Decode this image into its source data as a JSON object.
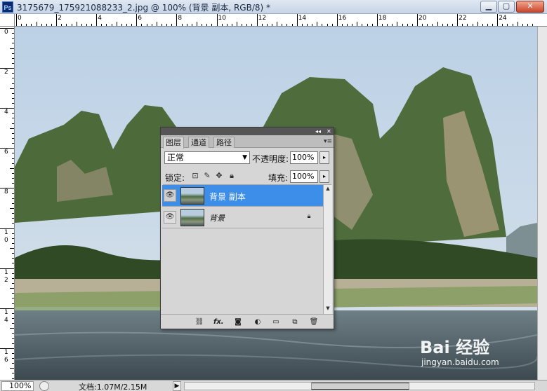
{
  "window": {
    "app_icon": "Ps",
    "title": "3175679_175921088233_2.jpg @ 100% (背景 副本, RGB/8) *",
    "buttons": {
      "minimize": "▁",
      "restore": "▢",
      "close": "✕"
    }
  },
  "ruler": {
    "top_labels": [
      "0",
      "2",
      "4",
      "6",
      "8",
      "10",
      "12",
      "14",
      "16",
      "18",
      "20",
      "22",
      "24"
    ],
    "left_labels": [
      "0",
      "2",
      "4",
      "6",
      "8",
      "1\n0",
      "1\n2",
      "1\n4",
      "1\n6"
    ]
  },
  "layers_panel": {
    "tabs": [
      {
        "label": "图层",
        "active": true
      },
      {
        "label": "通道",
        "active": false
      },
      {
        "label": "路径",
        "active": false
      }
    ],
    "collapse_icon": "◂◂",
    "close_icon": "✕",
    "menu_icon": "▾≡",
    "blend_mode": "正常",
    "opacity_label": "不透明度:",
    "opacity_value": "100%",
    "lock_label": "锁定:",
    "fill_label": "填充:",
    "fill_value": "100%",
    "layers": [
      {
        "name": "背景 副本",
        "selected": true,
        "visible": true,
        "locked": false
      },
      {
        "name": "背景",
        "selected": false,
        "visible": true,
        "locked": true
      }
    ],
    "bottom_icons": [
      "link-icon",
      "fx-icon",
      "mask-icon",
      "adjustment-icon",
      "folder-icon",
      "new-layer-icon",
      "trash-icon"
    ],
    "fx_label": "fx."
  },
  "status": {
    "zoom": "100%",
    "doc_info": "文档:1.07M/2.15M"
  },
  "watermark": {
    "logo": "Bai 经验",
    "url": "jingyan.baidu.com"
  },
  "colors": {
    "selection": "#3d8ee8",
    "panel_bg": "#d6d6d6"
  }
}
